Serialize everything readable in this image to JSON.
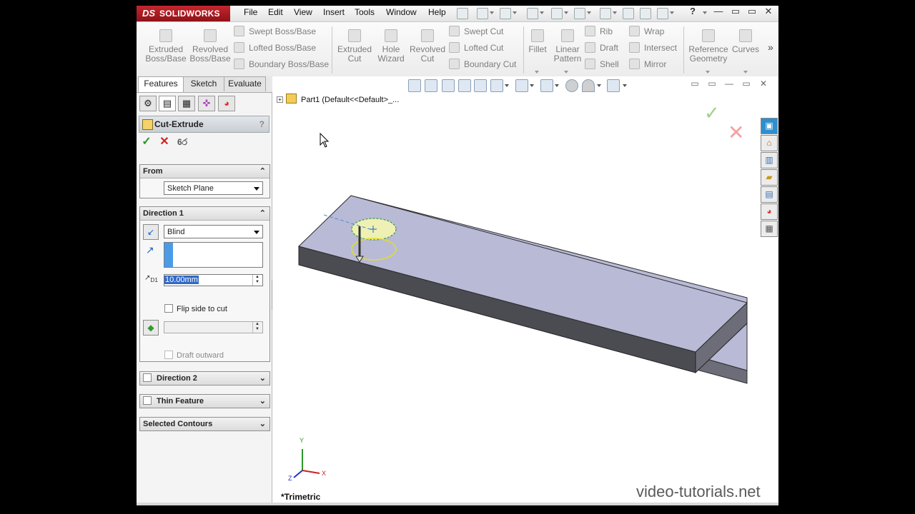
{
  "app": {
    "brand_ds": "DS",
    "brand_name": "SOLIDWORKS"
  },
  "menu": [
    "File",
    "Edit",
    "View",
    "Insert",
    "Tools",
    "Window",
    "Help"
  ],
  "window_controls": {
    "minimize": "—",
    "restore": "▭",
    "close": "✕",
    "help": "?"
  },
  "commands": {
    "extruded_boss": "Extruded Boss/Base",
    "revolved_boss": "Revolved Boss/Base",
    "swept_boss": "Swept Boss/Base",
    "lofted_boss": "Lofted Boss/Base",
    "boundary_boss": "Boundary Boss/Base",
    "extruded_cut": "Extruded Cut",
    "hole_wizard": "Hole Wizard",
    "revolved_cut": "Revolved Cut",
    "swept_cut": "Swept Cut",
    "lofted_cut": "Lofted Cut",
    "boundary_cut": "Boundary Cut",
    "fillet": "Fillet",
    "linear_pattern": "Linear Pattern",
    "rib": "Rib",
    "draft": "Draft",
    "shell": "Shell",
    "wrap": "Wrap",
    "intersect": "Intersect",
    "mirror": "Mirror",
    "reference_geometry": "Reference Geometry",
    "curves": "Curves",
    "more": "»"
  },
  "tabs": [
    "Features",
    "Sketch",
    "Evaluate"
  ],
  "property_manager": {
    "title": "Cut-Extrude",
    "help": "?",
    "from": {
      "header": "From",
      "value": "Sketch Plane"
    },
    "direction1": {
      "header": "Direction 1",
      "end_condition": "Blind",
      "depth": "10.00mm",
      "flip_side": "Flip side to cut",
      "draft_outward": "Draft outward"
    },
    "direction2": {
      "header": "Direction 2"
    },
    "thin_feature": {
      "header": "Thin Feature"
    },
    "selected_contours": {
      "header": "Selected Contours"
    }
  },
  "tree": {
    "root_label": "Part1  (Default<<Default>_..."
  },
  "view": {
    "orientation": "*Trimetric",
    "axes": {
      "x": "X",
      "y": "Y",
      "z": "Z"
    }
  },
  "confirm": {
    "ok": "✓",
    "cancel": "✕"
  },
  "watermark": "video-tutorials.net",
  "colors": {
    "brand_red": "#b5161f",
    "top_face": "#b9bad6",
    "front_face": "#4b4b52",
    "side_face": "#6c6d78",
    "sketch_fill": "#eef0b4",
    "sketch_outline": "#e0df2a"
  }
}
